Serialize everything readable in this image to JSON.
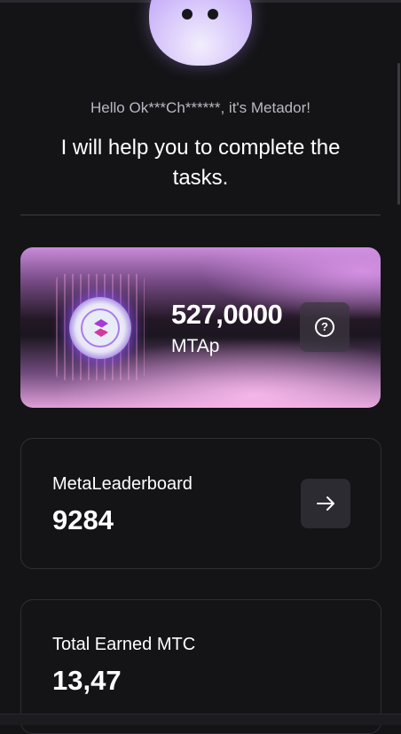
{
  "greeting": "Hello Ok***Ch******, it's Metador!",
  "headline": "I will help you to complete the tasks.",
  "balance": {
    "value": "527,0000",
    "unit": "MTAp",
    "help_icon": "question-circle-icon",
    "coin_icon": "metador-coin-icon"
  },
  "leaderboard": {
    "label": "MetaLeaderboard",
    "value": "9284",
    "action_icon": "arrow-right-icon"
  },
  "earned": {
    "label": "Total Earned MTC",
    "value": "13,47"
  },
  "colors": {
    "background": "#141417",
    "card_border": "#2f2f35",
    "accent_purple": "#b591f2",
    "text_muted": "#b8b8c2"
  }
}
